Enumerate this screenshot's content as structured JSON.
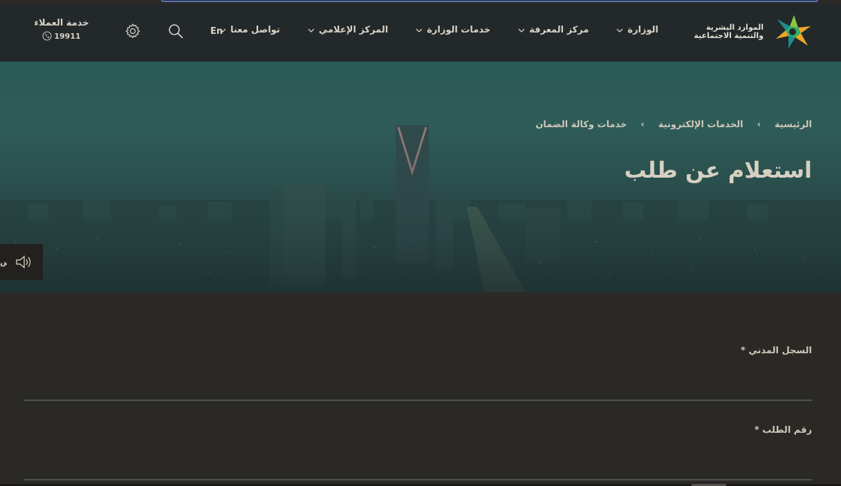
{
  "header": {
    "logo_text_line1": "الموارد البشرية",
    "logo_text_line2": "والتنمية الاجتماعية",
    "nav": [
      {
        "label": "الوزارة"
      },
      {
        "label": "مركز المعرفة"
      },
      {
        "label": "خدمات الوزارة"
      },
      {
        "label": "المركز الإعلامي"
      },
      {
        "label": "تواصل معنا"
      }
    ],
    "lang_label": "En",
    "customer_service_title": "خدمة العملاء",
    "customer_service_phone": "19911"
  },
  "hero": {
    "breadcrumb": [
      "الرئيسية",
      "الخدمات الإلكترونية",
      "خدمات وكالة الضمان"
    ],
    "title": "استعلام عن طلب",
    "listen_label": "اس"
  },
  "form": {
    "field1_label": "السجل المدني *",
    "field1_value": "",
    "field2_label": "رقم الطلب *",
    "field2_value": ""
  },
  "colors": {
    "header_bg": "#23282a",
    "page_bg": "#2b2926",
    "hero_tint": "#2f5d59",
    "logo_green": "#2fae6a",
    "logo_orange": "#f0a526",
    "logo_teal": "#1c8c8c"
  }
}
